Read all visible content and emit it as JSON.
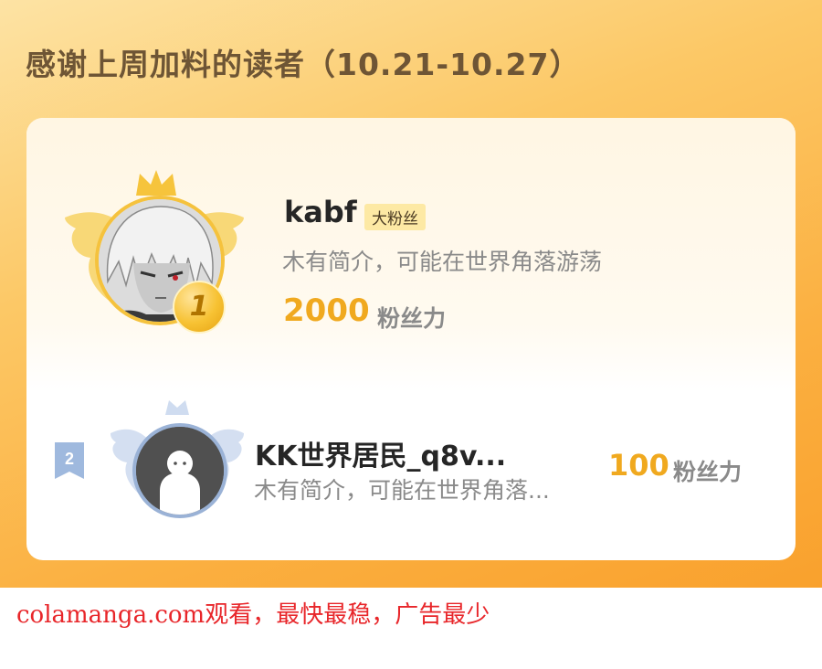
{
  "header": {
    "title": "感谢上周加料的读者（10.21-10.27）"
  },
  "leaderboard": [
    {
      "rank": "1",
      "name": "kabf",
      "badge": "大粉丝",
      "description": "木有简介，可能在世界角落游荡",
      "score": "2000",
      "score_unit": "粉丝力",
      "avatar_icon": "anime-character-avatar",
      "emblem_icon": "gold-crown-wings-icon"
    },
    {
      "rank": "2",
      "name": "KK世界居民_q8v...",
      "description": "木有简介，可能在世界角落...",
      "score": "100",
      "score_unit": "粉丝力",
      "avatar_icon": "default-ghost-avatar",
      "emblem_icon": "silver-wings-icon"
    }
  ],
  "footer": {
    "watermark": "colamanga.com观看，最快最稳，广告最少"
  },
  "colors": {
    "accent": "#f0a91f",
    "title": "#6e5535",
    "gold": "#f5c23d",
    "silver": "#9ab2d6",
    "watermark": "#e8262a"
  }
}
